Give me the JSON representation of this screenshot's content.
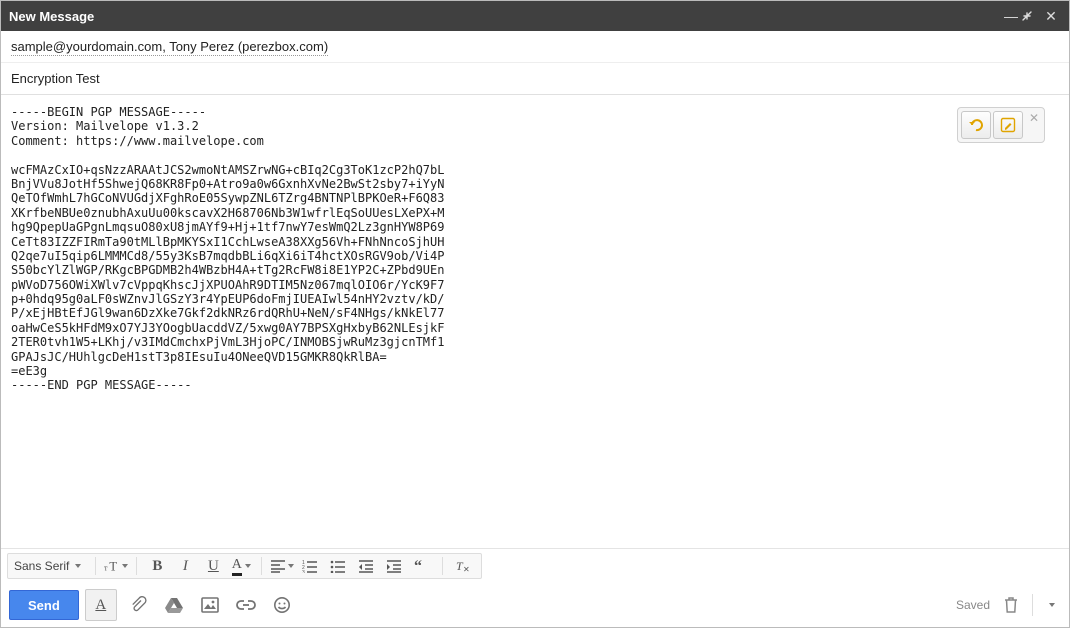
{
  "window": {
    "title": "New Message"
  },
  "header": {
    "recipients": "sample@yourdomain.com, Tony Perez (perezbox.com)",
    "subject": "Encryption Test"
  },
  "body": {
    "pgp": "-----BEGIN PGP MESSAGE-----\nVersion: Mailvelope v1.3.2\nComment: https://www.mailvelope.com\n\nwcFMAzCxIO+qsNzzARAAtJCS2wmoNtAMSZrwNG+cBIq2Cg3ToK1zcP2hQ7bL\nBnjVVu8JotHf5ShwejQ68KR8Fp0+Atro9a0w6GxnhXvNe2BwSt2sby7+iYyN\nQeTOfWmhL7hGCoNVUGdjXFghRoE05SywpZNL6TZrg4BNTNPlBPKOeR+F6Q83\nXKrfbeNBUe0znubhAxuUu00kscavX2H68706Nb3W1wfrlEqSoUUesLXePX+M\nhg9QpepUaGPgnLmqsuO80xU8jmAYf9+Hj+1tf7nwY7esWmQ2Lz3gnHYW8P69\nCeTt83IZZFIRmTa90tMLlBpMKYSxI1CchLwseA38XXg56Vh+FNhNncoSjhUH\nQ2qe7uI5qip6LMMMCd8/55y3KsB7mqdbBLi6qXi6iT4hctXOsRGV9ob/Vi4P\nS50bcYlZlWGP/RKgcBPGDMB2h4WBzbH4A+tTg2RcFW8i8E1YP2C+ZPbd9UEn\npWVoD756OWiXWlv7cVppqKhscJjXPUOAhR9DTIM5Nz067mqlOIO6r/YcK9F7\np+0hdq95g0aLF0sWZnvJlGSzY3r4YpEUP6doFmjIUEAIwl54nHY2vztv/kD/\nP/xEjHBtEfJGl9wan6DzXke7Gkf2dkNRz6rdQRhU+NeN/sF4NHgs/kNkEl77\noaHwCeS5kHFdM9xO7YJ3YOogbUacddVZ/5xwg0AY7BPSXgHxbyB62NLEsjkF\n2TER0tvh1W5+LKhj/v3IMdCmchxPjVmL3HjoPC/INMOBSjwRuMz3gjcnTMf1\nGPAJsJC/HUhlgcDeH1stT3p8IEsuIu4ONeeQVD15GMKR8QkRlBA=\n=eE3g\n-----END PGP MESSAGE-----"
  },
  "format": {
    "font_family": "Sans Serif"
  },
  "footer": {
    "send_label": "Send",
    "status": "Saved"
  },
  "colors": {
    "send_bg": "#4787ed",
    "titlebar_bg": "#404040"
  }
}
